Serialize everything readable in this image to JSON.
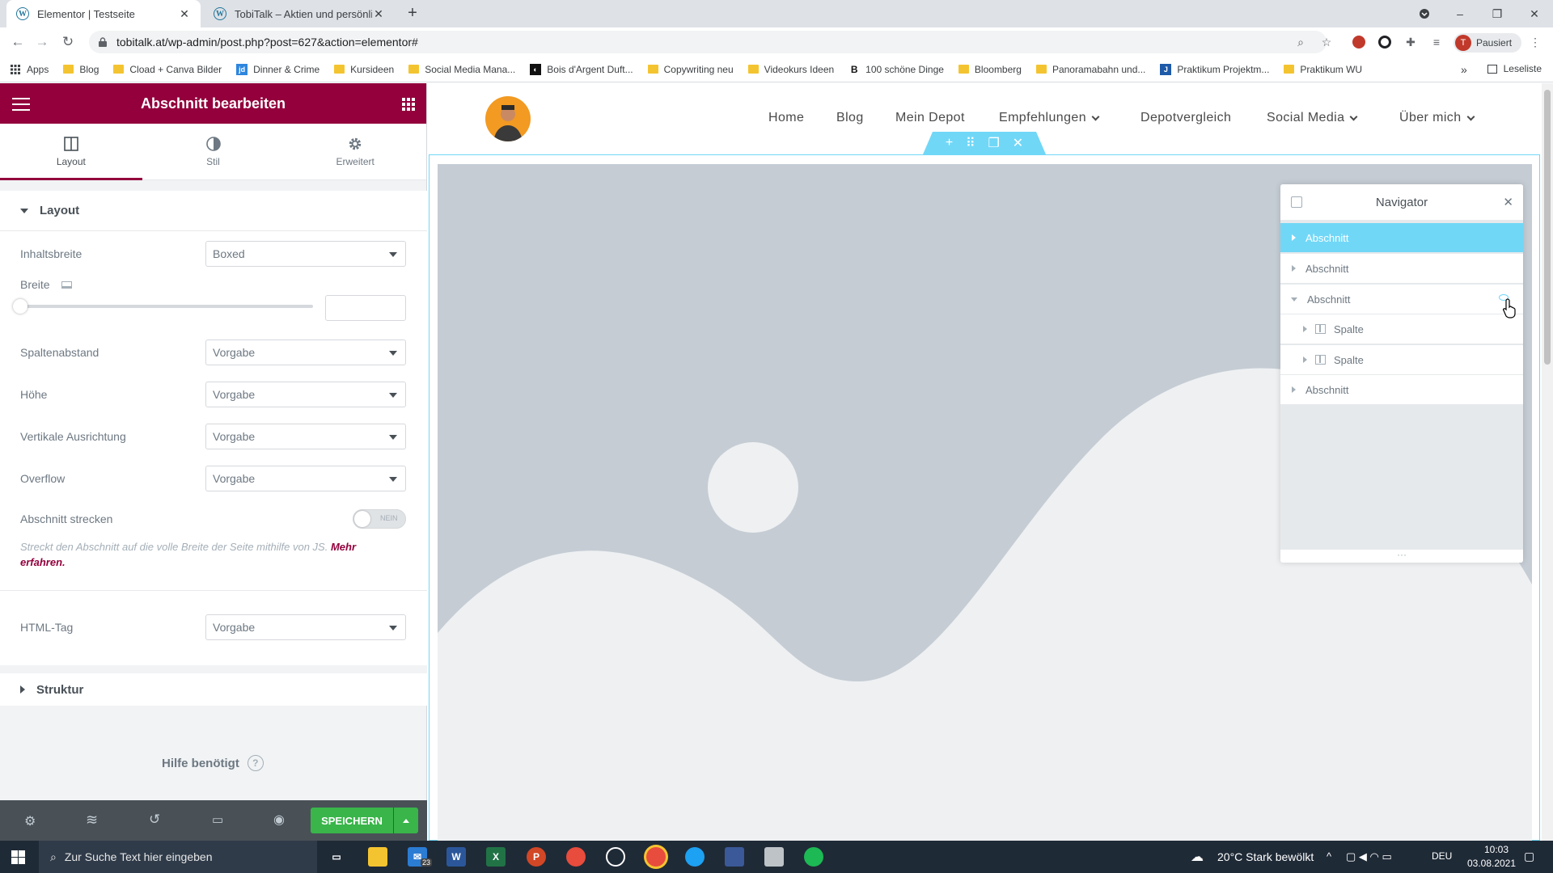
{
  "browser": {
    "tabs": [
      {
        "title": "Elementor | Testseite",
        "active": true
      },
      {
        "title": "TobiTalk – Aktien und persönliche",
        "active": false
      }
    ],
    "new_tab": "+",
    "url": "tobitalk.at/wp-admin/post.php?post=627&action=elementor#",
    "profile_label": "Pausiert",
    "profile_initial": "T",
    "bookmarks": [
      {
        "label": "Apps",
        "icon": "apps-grid-icon"
      },
      {
        "label": "Blog",
        "icon": "folder-icon"
      },
      {
        "label": "Cload + Canva Bilder",
        "icon": "folder-icon"
      },
      {
        "label": "Dinner & Crime",
        "icon": "jd-icon"
      },
      {
        "label": "Kursideen",
        "icon": "folder-icon"
      },
      {
        "label": "Social Media Mana...",
        "icon": "folder-icon"
      },
      {
        "label": "Bois d'Argent Duft...",
        "icon": "bois-icon"
      },
      {
        "label": "Copywriting neu",
        "icon": "folder-icon"
      },
      {
        "label": "Videokurs Ideen",
        "icon": "folder-icon"
      },
      {
        "label": "100 schöne Dinge",
        "icon": "b-icon"
      },
      {
        "label": "Bloomberg",
        "icon": "folder-icon"
      },
      {
        "label": "Panoramabahn und...",
        "icon": "folder-icon"
      },
      {
        "label": "Praktikum Projektm...",
        "icon": "j-icon"
      },
      {
        "label": "Praktikum WU",
        "icon": "folder-icon"
      }
    ],
    "more_bookmarks": "»",
    "reading_list": "Leseliste"
  },
  "panel": {
    "title": "Abschnitt bearbeiten",
    "tabs": [
      {
        "label": "Layout",
        "icon": "layout-icon"
      },
      {
        "label": "Stil",
        "icon": "contrast-icon"
      },
      {
        "label": "Erweitert",
        "icon": "gear-icon"
      }
    ],
    "section_layout": "Layout",
    "fields": {
      "inhaltsbreite": {
        "label": "Inhaltsbreite",
        "value": "Boxed"
      },
      "breite": {
        "label": "Breite",
        "value": ""
      },
      "spaltenabstand": {
        "label": "Spaltenabstand",
        "value": "Vorgabe"
      },
      "hoehe": {
        "label": "Höhe",
        "value": "Vorgabe"
      },
      "vertikale": {
        "label": "Vertikale Ausrichtung",
        "value": "Vorgabe"
      },
      "overflow": {
        "label": "Overflow",
        "value": "Vorgabe"
      },
      "strecken": {
        "label": "Abschnitt strecken",
        "toggle": "NEIN"
      },
      "strecken_hint": "Streckt den Abschnitt auf die volle Breite der Seite mithilfe von JS.",
      "strecken_link": "Mehr erfahren.",
      "htmltag": {
        "label": "HTML-Tag",
        "value": "Vorgabe"
      }
    },
    "section_struktur": "Struktur",
    "help": "Hilfe benötigt",
    "save": "SPEICHERN"
  },
  "site": {
    "menu": [
      "Home",
      "Blog",
      "Mein Depot",
      "Empfehlungen",
      "Depotvergleich",
      "Social Media",
      "Über mich"
    ]
  },
  "navigator": {
    "title": "Navigator",
    "items": [
      {
        "label": "Abschnitt",
        "level": 0,
        "state": "selected"
      },
      {
        "label": "Abschnitt",
        "level": 0,
        "state": "collapsed"
      },
      {
        "label": "Abschnitt",
        "level": 0,
        "state": "expanded"
      },
      {
        "label": "Spalte",
        "level": 1,
        "state": "collapsed"
      },
      {
        "label": "Spalte",
        "level": 1,
        "state": "collapsed"
      },
      {
        "label": "Abschnitt",
        "level": 0,
        "state": "collapsed"
      }
    ],
    "footer": "···"
  },
  "taskbar": {
    "search_placeholder": "Zur Suche Text hier eingeben",
    "weather": "20°C  Stark bewölkt",
    "lang": "DEU",
    "time": "10:03",
    "date": "03.08.2021",
    "mail_badge": "23"
  },
  "colors": {
    "elementor_brand": "#93003c",
    "selection_blue": "#71d7f7",
    "save_green": "#39b54a",
    "panel_bg": "#f1f3f5",
    "placeholder_bg": "#c5ccd4"
  }
}
